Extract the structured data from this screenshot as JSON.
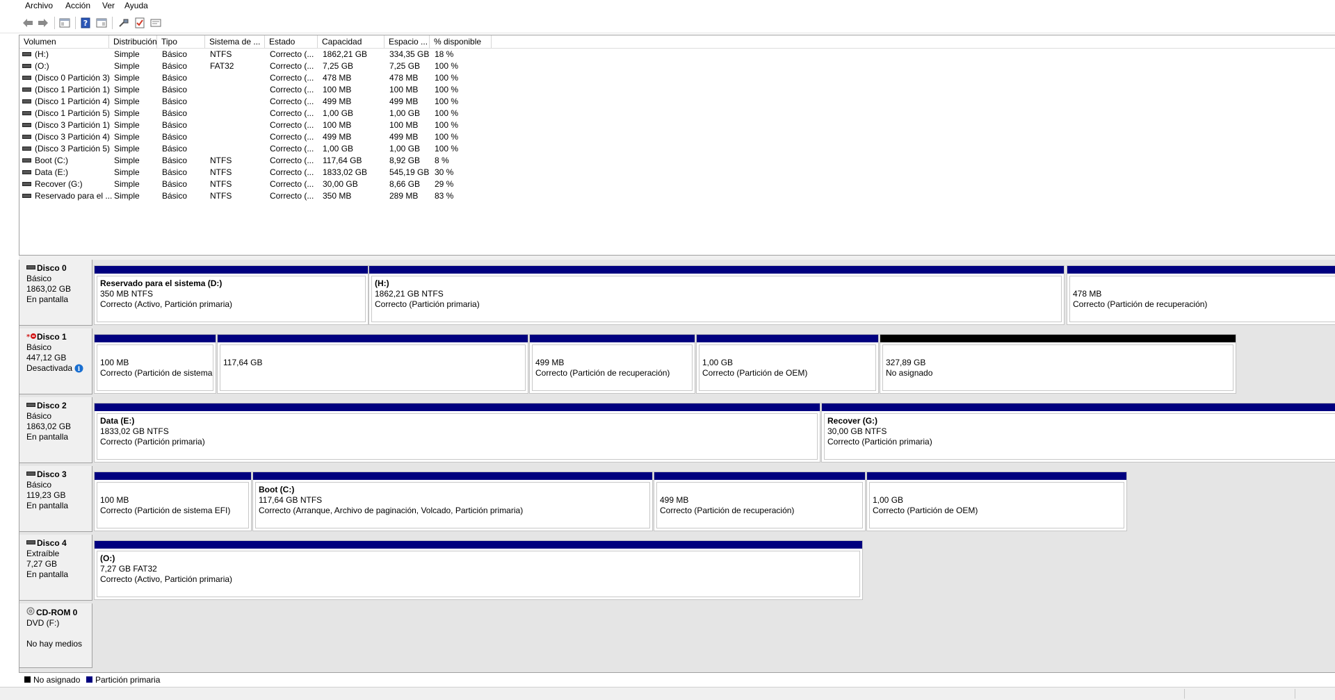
{
  "menu": [
    "Archivo",
    "Acción",
    "Ver",
    "Ayuda"
  ],
  "toolbar_icons": [
    "back-arrow-icon",
    "forward-arrow-icon",
    "console-tree-icon",
    "help-icon",
    "properties-icon",
    "connect-icon",
    "checklist-icon",
    "view-icon"
  ],
  "columns": [
    "Volumen",
    "Distribución",
    "Tipo",
    "Sistema de ...",
    "Estado",
    "Capacidad",
    "Espacio ...",
    "% disponible"
  ],
  "volumes": [
    {
      "name": "(H:)",
      "layout": "Simple",
      "type": "Básico",
      "fs": "NTFS",
      "status": "Correcto (...",
      "capacity": "1862,21 GB",
      "free": "334,35 GB",
      "pct": "18 %"
    },
    {
      "name": "(O:)",
      "layout": "Simple",
      "type": "Básico",
      "fs": "FAT32",
      "status": "Correcto (...",
      "capacity": "7,25 GB",
      "free": "7,25 GB",
      "pct": "100 %"
    },
    {
      "name": "(Disco 0 Partición 3)",
      "layout": "Simple",
      "type": "Básico",
      "fs": "",
      "status": "Correcto (...",
      "capacity": "478 MB",
      "free": "478 MB",
      "pct": "100 %"
    },
    {
      "name": "(Disco 1 Partición 1)",
      "layout": "Simple",
      "type": "Básico",
      "fs": "",
      "status": "Correcto (...",
      "capacity": "100 MB",
      "free": "100 MB",
      "pct": "100 %"
    },
    {
      "name": "(Disco 1 Partición 4)",
      "layout": "Simple",
      "type": "Básico",
      "fs": "",
      "status": "Correcto (...",
      "capacity": "499 MB",
      "free": "499 MB",
      "pct": "100 %"
    },
    {
      "name": "(Disco 1 Partición 5)",
      "layout": "Simple",
      "type": "Básico",
      "fs": "",
      "status": "Correcto (...",
      "capacity": "1,00 GB",
      "free": "1,00 GB",
      "pct": "100 %"
    },
    {
      "name": "(Disco 3 Partición 1)",
      "layout": "Simple",
      "type": "Básico",
      "fs": "",
      "status": "Correcto (...",
      "capacity": "100 MB",
      "free": "100 MB",
      "pct": "100 %"
    },
    {
      "name": "(Disco 3 Partición 4)",
      "layout": "Simple",
      "type": "Básico",
      "fs": "",
      "status": "Correcto (...",
      "capacity": "499 MB",
      "free": "499 MB",
      "pct": "100 %"
    },
    {
      "name": "(Disco 3 Partición 5)",
      "layout": "Simple",
      "type": "Básico",
      "fs": "",
      "status": "Correcto (...",
      "capacity": "1,00 GB",
      "free": "1,00 GB",
      "pct": "100 %"
    },
    {
      "name": "Boot (C:)",
      "layout": "Simple",
      "type": "Básico",
      "fs": "NTFS",
      "status": "Correcto (...",
      "capacity": "117,64 GB",
      "free": "8,92 GB",
      "pct": "8 %"
    },
    {
      "name": "Data (E:)",
      "layout": "Simple",
      "type": "Básico",
      "fs": "NTFS",
      "status": "Correcto (...",
      "capacity": "1833,02 GB",
      "free": "545,19 GB",
      "pct": "30 %"
    },
    {
      "name": "Recover (G:)",
      "layout": "Simple",
      "type": "Básico",
      "fs": "NTFS",
      "status": "Correcto (...",
      "capacity": "30,00 GB",
      "free": "8,66 GB",
      "pct": "29 %"
    },
    {
      "name": "Reservado para el ...",
      "layout": "Simple",
      "type": "Básico",
      "fs": "NTFS",
      "status": "Correcto (...",
      "capacity": "350 MB",
      "free": "289 MB",
      "pct": "83 %"
    }
  ],
  "disks": [
    {
      "title": "Disco 0",
      "type": "Básico",
      "size": "1863,02 GB",
      "state": "En pantalla",
      "icon": "disk-icon",
      "partitions": [
        {
          "name": "Reservado para el sistema  (D:)",
          "line1": "350 MB NTFS",
          "line2": "Correcto (Activo, Partición primaria)",
          "bar": "primary"
        },
        {
          "name": "(H:)",
          "line1": "1862,21 GB NTFS",
          "line2": "Correcto (Partición primaria)",
          "bar": "primary"
        },
        {
          "name": "",
          "line1": "478 MB",
          "line2": "Correcto (Partición de recuperación)",
          "bar": "primary"
        }
      ]
    },
    {
      "title": "Disco 1",
      "type": "Básico",
      "size": "447,12 GB",
      "state": "Desactivada",
      "icon": "offline-disk-icon",
      "partitions": [
        {
          "name": "",
          "line1": "100 MB",
          "line2": "Correcto (Partición de sistema",
          "bar": "primary"
        },
        {
          "name": "",
          "line1": "117,64 GB",
          "line2": "",
          "bar": "primary"
        },
        {
          "name": "",
          "line1": "499 MB",
          "line2": "Correcto (Partición de recuperación)",
          "bar": "primary"
        },
        {
          "name": "",
          "line1": "1,00 GB",
          "line2": "Correcto (Partición de OEM)",
          "bar": "primary"
        },
        {
          "name": "",
          "line1": "327,89 GB",
          "line2": "No asignado",
          "bar": "unallocated"
        }
      ]
    },
    {
      "title": "Disco 2",
      "type": "Básico",
      "size": "1863,02 GB",
      "state": "En pantalla",
      "icon": "disk-icon",
      "partitions": [
        {
          "name": "Data  (E:)",
          "line1": "1833,02 GB NTFS",
          "line2": "Correcto (Partición primaria)",
          "bar": "primary"
        },
        {
          "name": "Recover  (G:)",
          "line1": "30,00 GB NTFS",
          "line2": "Correcto (Partición primaria)",
          "bar": "primary"
        }
      ]
    },
    {
      "title": "Disco 3",
      "type": "Básico",
      "size": "119,23 GB",
      "state": "En pantalla",
      "icon": "disk-icon",
      "partitions": [
        {
          "name": "",
          "line1": "100 MB",
          "line2": "Correcto (Partición de sistema EFI)",
          "bar": "primary"
        },
        {
          "name": "Boot  (C:)",
          "line1": "117,64 GB NTFS",
          "line2": "Correcto (Arranque, Archivo de paginación, Volcado, Partición primaria)",
          "bar": "primary"
        },
        {
          "name": "",
          "line1": "499 MB",
          "line2": "Correcto (Partición de recuperación)",
          "bar": "primary"
        },
        {
          "name": "",
          "line1": "1,00 GB",
          "line2": "Correcto (Partición de OEM)",
          "bar": "primary"
        }
      ]
    },
    {
      "title": "Disco 4",
      "type": "Extraíble",
      "size": "7,27 GB",
      "state": "En pantalla",
      "icon": "disk-icon",
      "partitions": [
        {
          "name": "(O:)",
          "line1": "7,27 GB FAT32",
          "line2": "Correcto (Activo, Partición primaria)",
          "bar": "primary"
        }
      ]
    },
    {
      "title": "CD-ROM 0",
      "type": "DVD (F:)",
      "size": "",
      "state": "No hay medios",
      "icon": "cdrom-icon",
      "partitions": []
    }
  ],
  "legend": {
    "unallocated": "No asignado",
    "primary": "Partición primaria"
  },
  "colors": {
    "primary": "#00007f",
    "unallocated": "#000000",
    "info": "#1a6fd1",
    "offline": "#d11a1a"
  }
}
